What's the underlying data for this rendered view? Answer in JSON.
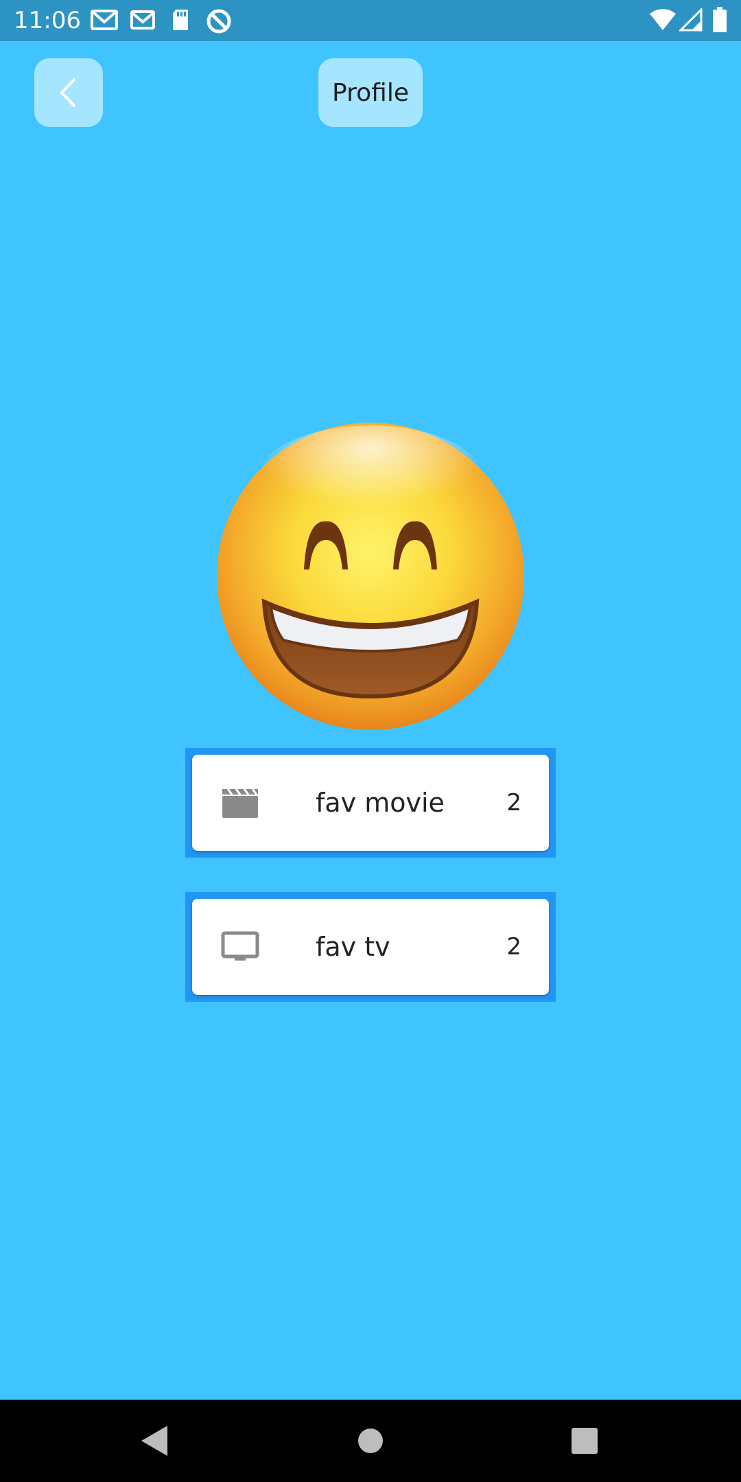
{
  "status_bar": {
    "time": "11:06"
  },
  "header": {
    "title": "Profile",
    "back_icon": "chevron-left-icon"
  },
  "avatar": {
    "icon": "grinning-face-emoji"
  },
  "cards": [
    {
      "icon": "movie-clapper-icon",
      "label": "fav movie",
      "count": "2"
    },
    {
      "icon": "tv-icon",
      "label": "fav tv",
      "count": "2"
    }
  ],
  "colors": {
    "background": "#40c4ff",
    "status_bar": "#2d93c3",
    "button_bg": "#a6e5ff",
    "card_frame": "#2196f3",
    "card_bg": "#ffffff"
  }
}
